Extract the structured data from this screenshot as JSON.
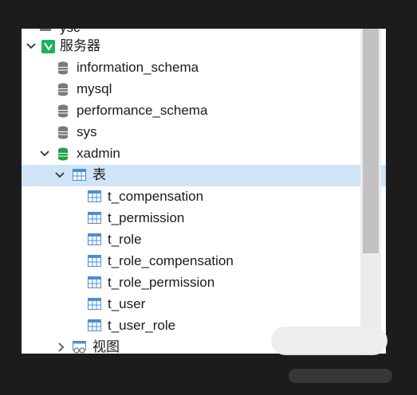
{
  "tree": {
    "top_partial": {
      "label": "ysc"
    },
    "server": {
      "label": "服务器"
    },
    "databases": [
      {
        "label": "information_schema"
      },
      {
        "label": "mysql"
      },
      {
        "label": "performance_schema"
      },
      {
        "label": "sys"
      }
    ],
    "active_db": {
      "label": "xadmin"
    },
    "tables_folder": {
      "label": "表"
    },
    "tables": [
      {
        "label": "t_compensation"
      },
      {
        "label": "t_permission"
      },
      {
        "label": "t_role"
      },
      {
        "label": "t_role_compensation"
      },
      {
        "label": "t_role_permission"
      },
      {
        "label": "t_user"
      },
      {
        "label": "t_user_role"
      }
    ],
    "views_folder": {
      "label": "视图"
    }
  },
  "colors": {
    "selection": "#cfe4f7",
    "server_icon": "#1fb15a",
    "active_db_icon": "#23a04a",
    "db_icon": "#7a7a7a",
    "table_icon": "#4a8fd4"
  }
}
